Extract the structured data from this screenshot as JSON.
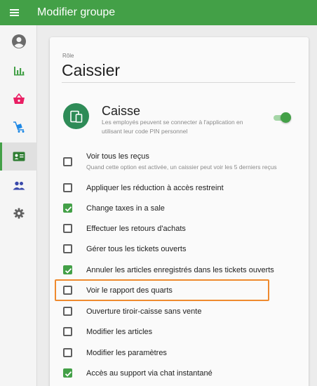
{
  "header": {
    "title": "Modifier groupe",
    "menu_icon": "hamburger-menu-icon"
  },
  "sidebar": {
    "items": [
      {
        "icon": "account-circle-icon",
        "active": false
      },
      {
        "icon": "bar-chart-icon",
        "active": false
      },
      {
        "icon": "basket-icon",
        "active": false
      },
      {
        "icon": "inventory-cart-icon",
        "active": false
      },
      {
        "icon": "badge-icon",
        "active": true
      },
      {
        "icon": "people-icon",
        "active": false
      },
      {
        "icon": "gear-icon",
        "active": false
      }
    ]
  },
  "role": {
    "label": "Rôle",
    "name": "Caissier"
  },
  "pos_section": {
    "title": "Caisse",
    "description": "Les employés peuvent se connecter à l'application en utilisant leur code PIN personnel",
    "toggle_on": true,
    "icon": "devices-icon"
  },
  "permissions": [
    {
      "label": "Voir tous les reçus",
      "sub": "Quand cette option est activée, un caissier peut voir les 5 derniers reçus",
      "checked": false
    },
    {
      "label": "Appliquer les réduction à accès restreint",
      "checked": false
    },
    {
      "label": "Change taxes in a sale",
      "checked": true
    },
    {
      "label": "Effectuer les retours d'achats",
      "checked": false
    },
    {
      "label": "Gérer tous les tickets ouverts",
      "checked": false
    },
    {
      "label": "Annuler les articles enregistrés dans les tickets ouverts",
      "checked": true
    },
    {
      "label": "Voir le rapport des quarts",
      "checked": false,
      "highlighted": true
    },
    {
      "label": "Ouverture tiroir-caisse sans vente",
      "checked": false
    },
    {
      "label": "Modifier les articles",
      "checked": false
    },
    {
      "label": "Modifier les paramètres",
      "checked": false
    },
    {
      "label": "Accès au support via chat instantané",
      "checked": true
    }
  ],
  "colors": {
    "accent": "#43a047",
    "highlight": "#ef8a2e"
  }
}
